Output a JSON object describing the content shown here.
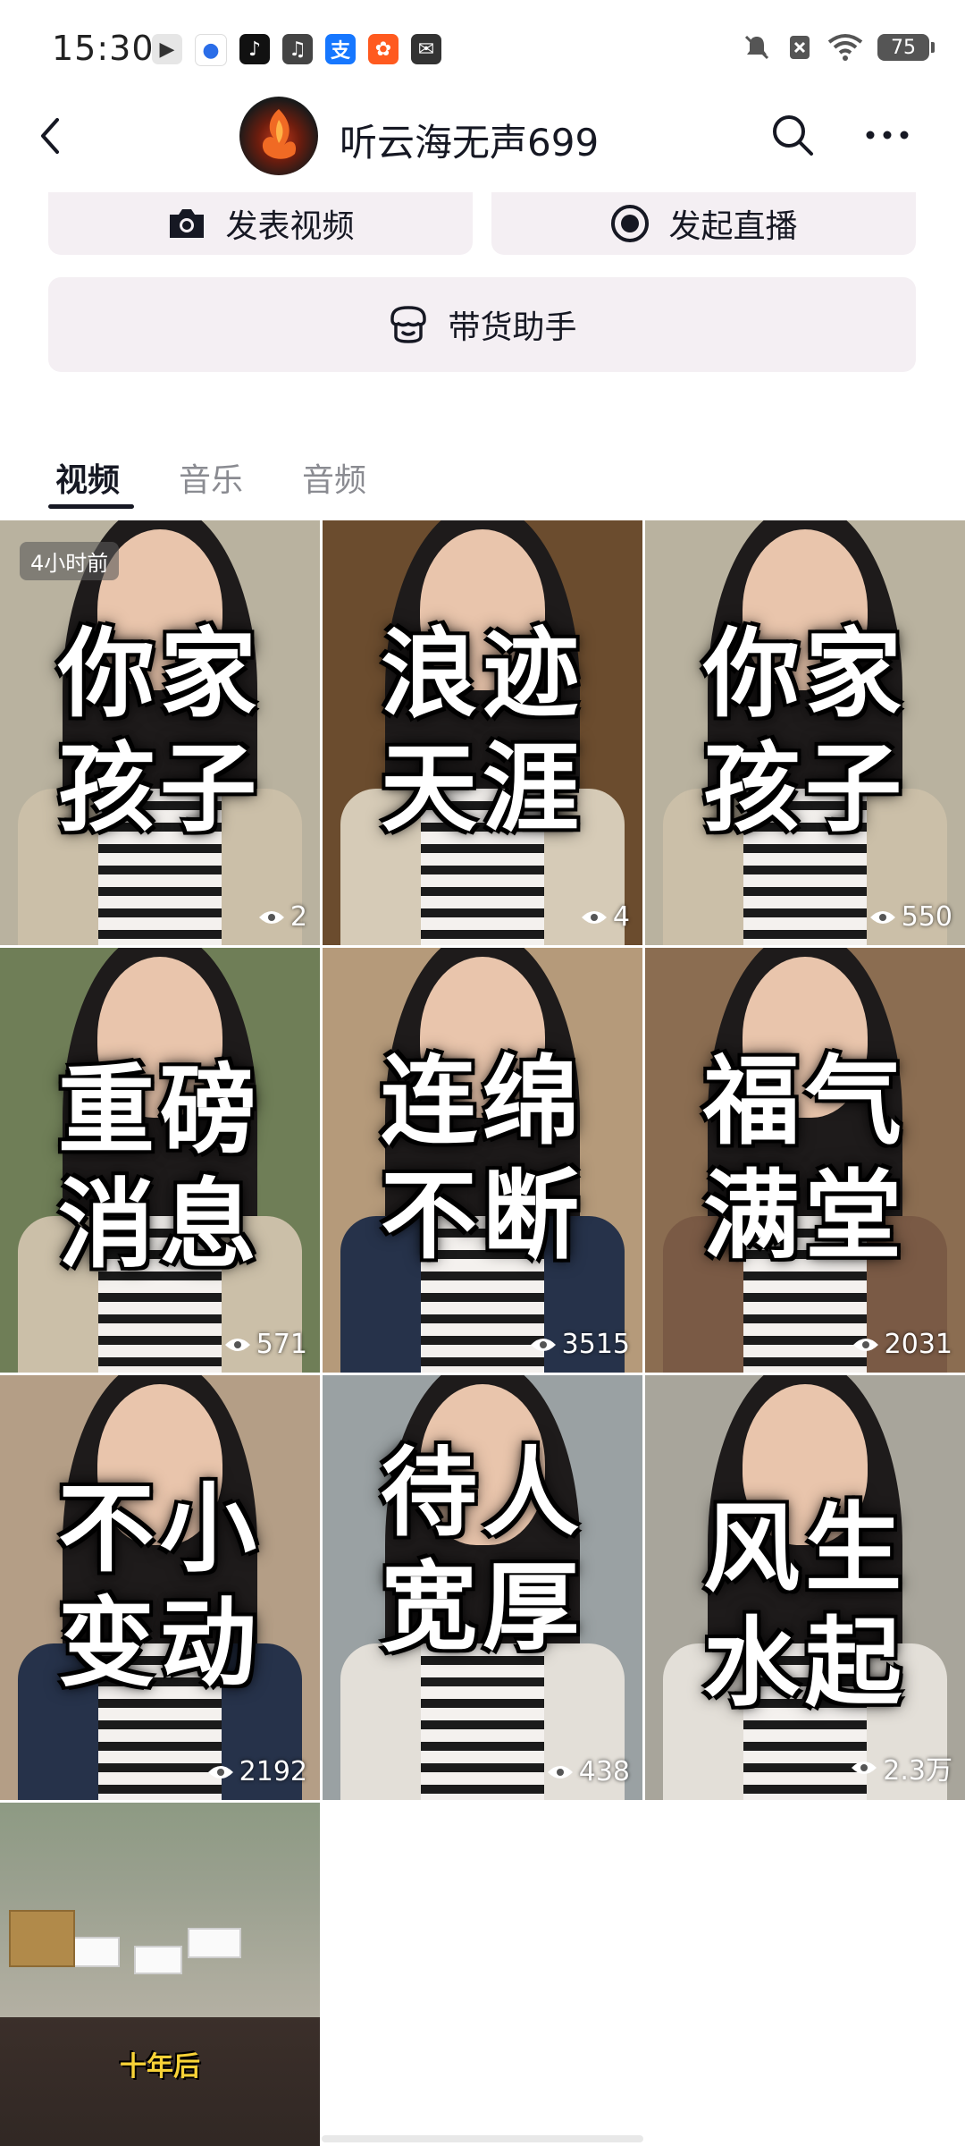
{
  "status_bar": {
    "time": "15:30",
    "battery": "75",
    "notification_icons": [
      "play-icon",
      "baidu-icon",
      "tiktok-icon",
      "music-icon",
      "alipay-icon",
      "shop-icon",
      "mail-icon"
    ]
  },
  "nav": {
    "profile_name": "听云海无声699"
  },
  "actions": {
    "publish_video": "发表视频",
    "start_live": "发起直播",
    "sales_assistant": "带货助手"
  },
  "tabs": [
    {
      "label": "视频",
      "active": true
    },
    {
      "label": "音乐",
      "active": false
    },
    {
      "label": "音频",
      "active": false
    }
  ],
  "videos": [
    {
      "caption_line1": "你家",
      "caption_line2": "孩子",
      "views": "2",
      "badge": "4小时前",
      "bg": "#b9b29f",
      "jacket": "#cbbfa8"
    },
    {
      "caption_line1": "浪迹",
      "caption_line2": "天涯",
      "views": "4",
      "badge": "",
      "bg": "#6b4c2e",
      "jacket": "#d6cbb7"
    },
    {
      "caption_line1": "你家",
      "caption_line2": "孩子",
      "views": "550",
      "badge": "",
      "bg": "#b9b29f",
      "jacket": "#cbbfa8"
    },
    {
      "caption_line1": "重磅",
      "caption_line2": "消息",
      "views": "571",
      "badge": "",
      "bg": "#6f7e57",
      "jacket": "#cbbfa8"
    },
    {
      "caption_line1": "连绵",
      "caption_line2": "不断",
      "views": "3515",
      "badge": "",
      "bg": "#b59a7a",
      "jacket": "#26324a"
    },
    {
      "caption_line1": "福气",
      "caption_line2": "满堂",
      "views": "2031",
      "badge": "",
      "bg": "#8b6d51",
      "jacket": "#7a5a45"
    },
    {
      "caption_line1": "不小",
      "caption_line2": "变动",
      "views": "2192",
      "badge": "",
      "bg": "#b49e86",
      "jacket": "#26324a"
    },
    {
      "caption_line1": "待人",
      "caption_line2": "宽厚",
      "views": "438",
      "badge": "",
      "bg": "#9aa1a3",
      "jacket": "#e3dfd8"
    },
    {
      "caption_line1": "风生",
      "caption_line2": "水起",
      "views": "2.3万",
      "badge": "",
      "bg": "#a8a59b",
      "jacket": "#e3dfd8"
    }
  ],
  "last_video": {
    "caption": "十年后"
  }
}
